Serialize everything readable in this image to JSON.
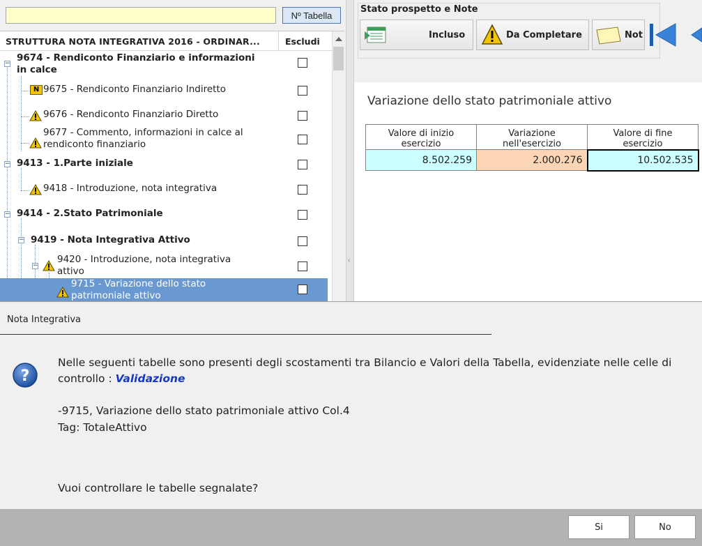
{
  "left_panel": {
    "search_value": "",
    "tabella_button_label": "Nº Tabella",
    "header_title": "STRUTTURA NOTA INTEGRATIVA 2016 - ORDINAR...",
    "header_escludi": "Escludi",
    "rows": [
      {
        "line1": "9674 - Rendiconto Finanziario e informazioni",
        "line2": "in calce",
        "bold": true,
        "icon": "",
        "checked": false
      },
      {
        "line1": "9675 - Rendiconto Finanziario Indiretto",
        "line2": "",
        "bold": false,
        "icon": "n-badge-icon",
        "checked": false
      },
      {
        "line1": "9676 - Rendiconto Finanziario Diretto",
        "line2": "",
        "bold": false,
        "icon": "warning-icon",
        "checked": false
      },
      {
        "line1": "9677 - Commento, informazioni in calce al",
        "line2": "rendiconto finanziario",
        "bold": false,
        "icon": "warning-icon",
        "checked": false
      },
      {
        "line1": "9413 - 1.Parte iniziale",
        "line2": "",
        "bold": true,
        "icon": "",
        "checked": false
      },
      {
        "line1": "9418 - Introduzione, nota integrativa",
        "line2": "",
        "bold": false,
        "icon": "warning-icon",
        "checked": false
      },
      {
        "line1": "9414 - 2.Stato Patrimoniale",
        "line2": "",
        "bold": true,
        "icon": "",
        "checked": false
      },
      {
        "line1": "9419 - Nota Integrativa Attivo",
        "line2": "",
        "bold": true,
        "icon": "",
        "checked": false
      },
      {
        "line1": "9420 - Introduzione, nota integrativa",
        "line2": "attivo",
        "bold": false,
        "icon": "warning-icon",
        "checked": false
      },
      {
        "line1": "9715 - Variazione dello stato",
        "line2": "patrimoniale attivo",
        "bold": false,
        "icon": "warning-icon",
        "checked": false,
        "selected": true
      }
    ]
  },
  "status": {
    "title": "Stato prospetto e Note",
    "buttons": [
      "Incluso",
      "Da Completare",
      "Not"
    ]
  },
  "table": {
    "title": "Variazione dello stato patrimoniale attivo",
    "headers": [
      {
        "l1": "Valore di inizio",
        "l2": "esercizio"
      },
      {
        "l1": "Variazione",
        "l2": "nell'esercizio"
      },
      {
        "l1": "Valore di fine",
        "l2": "esercizio"
      }
    ],
    "values": [
      "8.502.259",
      "2.000.276",
      "10.502.535"
    ],
    "colors": {
      "inizio": "#ccffff",
      "variazione": "#fcd5b4",
      "fine": "#ccffff"
    }
  },
  "dialog": {
    "title": "Nota Integrativa",
    "message_main": "Nelle seguenti tabelle sono presenti degli scostamenti tra Bilancio e Valori della Tabella, evidenziate nelle celle di controllo : ",
    "message_emphasis": "Validazione",
    "detail": "-9715, Variazione dello stato patrimoniale attivo Col.4",
    "tag": "Tag: TotaleAttivo",
    "question": "Vuoi controllare le tabelle segnalate?",
    "btn_yes": "Si",
    "btn_no": "No",
    "icon": "question-icon"
  },
  "colors": {
    "selection": "#6a98d0",
    "link_blue": "#1638c0",
    "search_bg": "#ffffcc"
  }
}
